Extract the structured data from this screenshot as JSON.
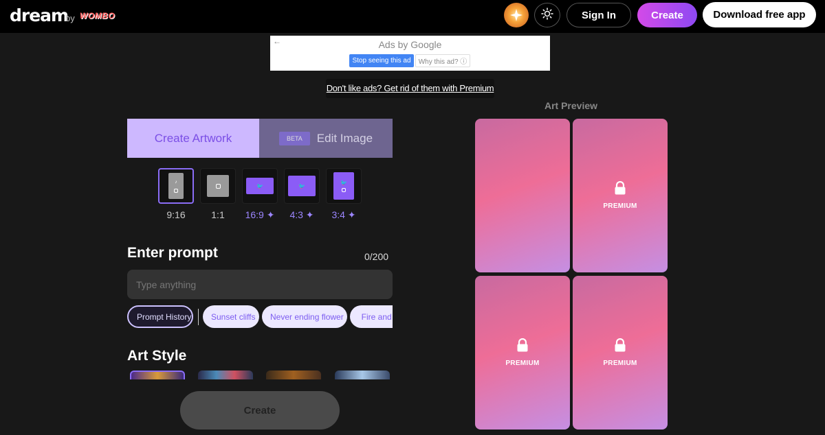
{
  "header": {
    "logo": "dream",
    "by": "by",
    "brand": "WOMBO",
    "signin_label": "Sign In",
    "create_label": "Create",
    "download_label": "Download free app"
  },
  "ad": {
    "title": "Ads by Google",
    "stop_label": "Stop seeing this ad",
    "why_label": "Why this ad? ⓘ",
    "remove_link": "Don't like ads? Get rid of them with Premium"
  },
  "tabs": {
    "create_label": "Create Artwork",
    "edit_label": "Edit Image",
    "beta_label": "BETA"
  },
  "ratios": [
    {
      "label": "9:16",
      "premium": false
    },
    {
      "label": "1:1",
      "premium": false
    },
    {
      "label": "16:9 ✦",
      "premium": true
    },
    {
      "label": "4:3 ✦",
      "premium": true
    },
    {
      "label": "3:4 ✦",
      "premium": true
    }
  ],
  "prompt": {
    "heading": "Enter prompt",
    "count": "0/200",
    "placeholder": "Type anything",
    "chips": [
      "Prompt History",
      "Sunset cliffs",
      "Never ending flower",
      "Fire and water"
    ]
  },
  "art_style": {
    "heading": "Art Style"
  },
  "main_create_label": "Create",
  "preview": {
    "title": "Art Preview",
    "premium_label": "PREMIUM"
  },
  "colors": {
    "accent": "#8b5cf6",
    "create_gradient_start": "#d34ae8",
    "create_gradient_end": "#8e49f2",
    "background": "#181818"
  }
}
